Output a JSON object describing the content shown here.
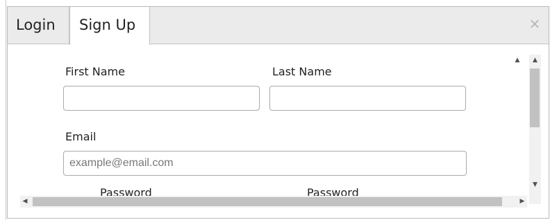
{
  "tabs": [
    {
      "label": "Login",
      "active": false
    },
    {
      "label": "Sign Up",
      "active": true
    }
  ],
  "close": {
    "glyph": "×",
    "icon": "close-icon"
  },
  "form": {
    "first_name": {
      "label": "First Name",
      "value": "",
      "placeholder": ""
    },
    "last_name": {
      "label": "Last Name",
      "value": "",
      "placeholder": ""
    },
    "email": {
      "label": "Email",
      "value": "",
      "placeholder": "example@email.com"
    },
    "password": {
      "label": "Password"
    },
    "confirm_password": {
      "label": "Password"
    }
  },
  "scrollbars": {
    "vertical": {
      "up_glyph": "▲",
      "down_glyph": "▼",
      "up_icon": "scroll-up-arrow-icon",
      "down_icon": "scroll-down-arrow-icon"
    },
    "horizontal": {
      "left_glyph": "◀",
      "right_glyph": "▶",
      "left_icon": "scroll-left-arrow-icon",
      "right_icon": "scroll-right-arrow-icon"
    }
  },
  "colors": {
    "tab_bar_bg": "#ebebeb",
    "active_tab_bg": "#ffffff",
    "border": "#c4c4c4",
    "close": "#b3b3b3",
    "scroll_thumb": "#c1c1c1"
  }
}
